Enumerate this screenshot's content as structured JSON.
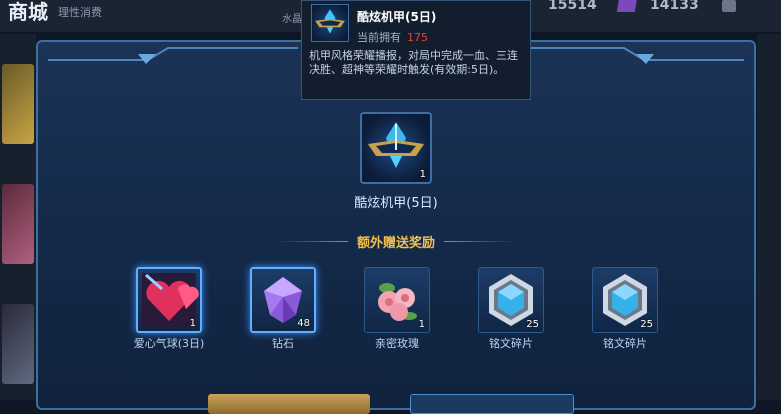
{
  "background": {
    "title": "商城",
    "subtitle": "理性消费",
    "coupon_label": "水晶",
    "currency_a": "15514",
    "currency_b": "14133"
  },
  "tooltip": {
    "name": "酷炫机甲(5日)",
    "own_label": "当前拥有",
    "own_count": "175",
    "description": "机甲风格荣耀播报，对局中完成一血、三连决胜、超神等荣耀时触发(有效期:5日)。"
  },
  "main_item": {
    "name": "酷炫机甲(5日)",
    "quantity": "1"
  },
  "bonus": {
    "title": "额外赠送奖励",
    "rewards": [
      {
        "name": "爱心气球(3日)",
        "quantity": "1",
        "icon": "heart-balloon-icon"
      },
      {
        "name": "钻石",
        "quantity": "48",
        "icon": "diamond-icon"
      },
      {
        "name": "亲密玫瑰",
        "quantity": "1",
        "icon": "rose-icon"
      },
      {
        "name": "铭文碎片",
        "quantity": "25",
        "icon": "inscription-fragment-icon"
      },
      {
        "name": "铭文碎片",
        "quantity": "25",
        "icon": "inscription-fragment-icon"
      }
    ]
  },
  "colors": {
    "gold": "#f0c04a",
    "own_count": "#e3413a",
    "frame": "#3f6f9e"
  }
}
